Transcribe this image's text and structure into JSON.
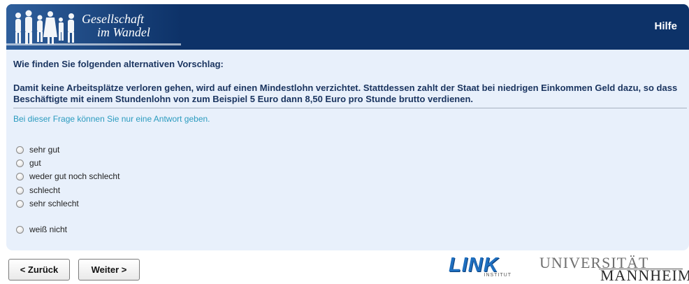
{
  "header": {
    "brand_line1": "Gesellschaft",
    "brand_line2": "im Wandel",
    "help_label": "Hilfe",
    "bg_color": "#0d3268"
  },
  "question": {
    "title": "Wie finden Sie folgenden alternativen Vorschlag:",
    "text": "Damit keine Arbeitsplätze verloren gehen, wird auf einen Mindestlohn verzichtet. Stattdessen zahlt der Staat bei niedrigen Einkommen Geld dazu, so dass Beschäftigte mit einem Stundenlohn von zum Beispiel 5 Euro dann 8,50 Euro pro Stunde brutto verdienen.",
    "hint": "Bei dieser Frage können Sie nur eine Antwort geben."
  },
  "options": [
    {
      "label": "sehr gut",
      "selected": false
    },
    {
      "label": "gut",
      "selected": false
    },
    {
      "label": "weder gut noch schlecht",
      "selected": false
    },
    {
      "label": "schlecht",
      "selected": false
    },
    {
      "label": "sehr schlecht",
      "selected": false
    },
    {
      "label": "weiß nicht",
      "selected": false
    }
  ],
  "nav": {
    "back_label": "< Zurück",
    "next_label": "Weiter >"
  },
  "logos": {
    "link_word": "LINK",
    "link_sub": "INSTITUT",
    "uni_top": "UNIVERSITÄT",
    "uni_bottom": "MANNHEIM"
  }
}
